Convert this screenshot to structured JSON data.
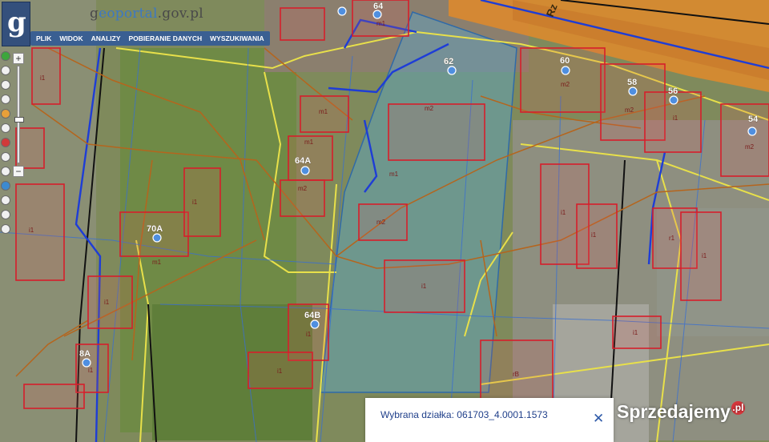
{
  "site": {
    "name_plain_1": "g",
    "name_accent": "eoportal",
    "name_plain_2": ".gov.pl",
    "logo_letter": "g"
  },
  "menu": {
    "items": [
      "PLIK",
      "WIDOK",
      "ANALIZY",
      "POBIERANIE DANYCH",
      "WYSZUKIWANIA"
    ]
  },
  "zoom": {
    "plus": "+",
    "minus": "−",
    "level_fraction": 0.55
  },
  "map": {
    "address_numbers": [
      "64",
      "62",
      "60",
      "58",
      "56",
      "54",
      "64A",
      "70A",
      "64B",
      "8A"
    ],
    "building_labels": [
      "m1",
      "m2",
      "i1",
      "r1",
      "rB"
    ],
    "street_fragment": "Rz",
    "colors": {
      "parcel_border": "#e8e04a",
      "building_outline": "#d61e2b",
      "utility_line": "#b5651d",
      "water_line": "#1e3dd6",
      "selected_parcel_fill": "#5aa7c9"
    }
  },
  "popup": {
    "label": "Wybrana działka: 061703_4.0001.1573",
    "close": "✕"
  },
  "watermark": {
    "text": "Sprzedajemy",
    "suffix": ".pl"
  }
}
